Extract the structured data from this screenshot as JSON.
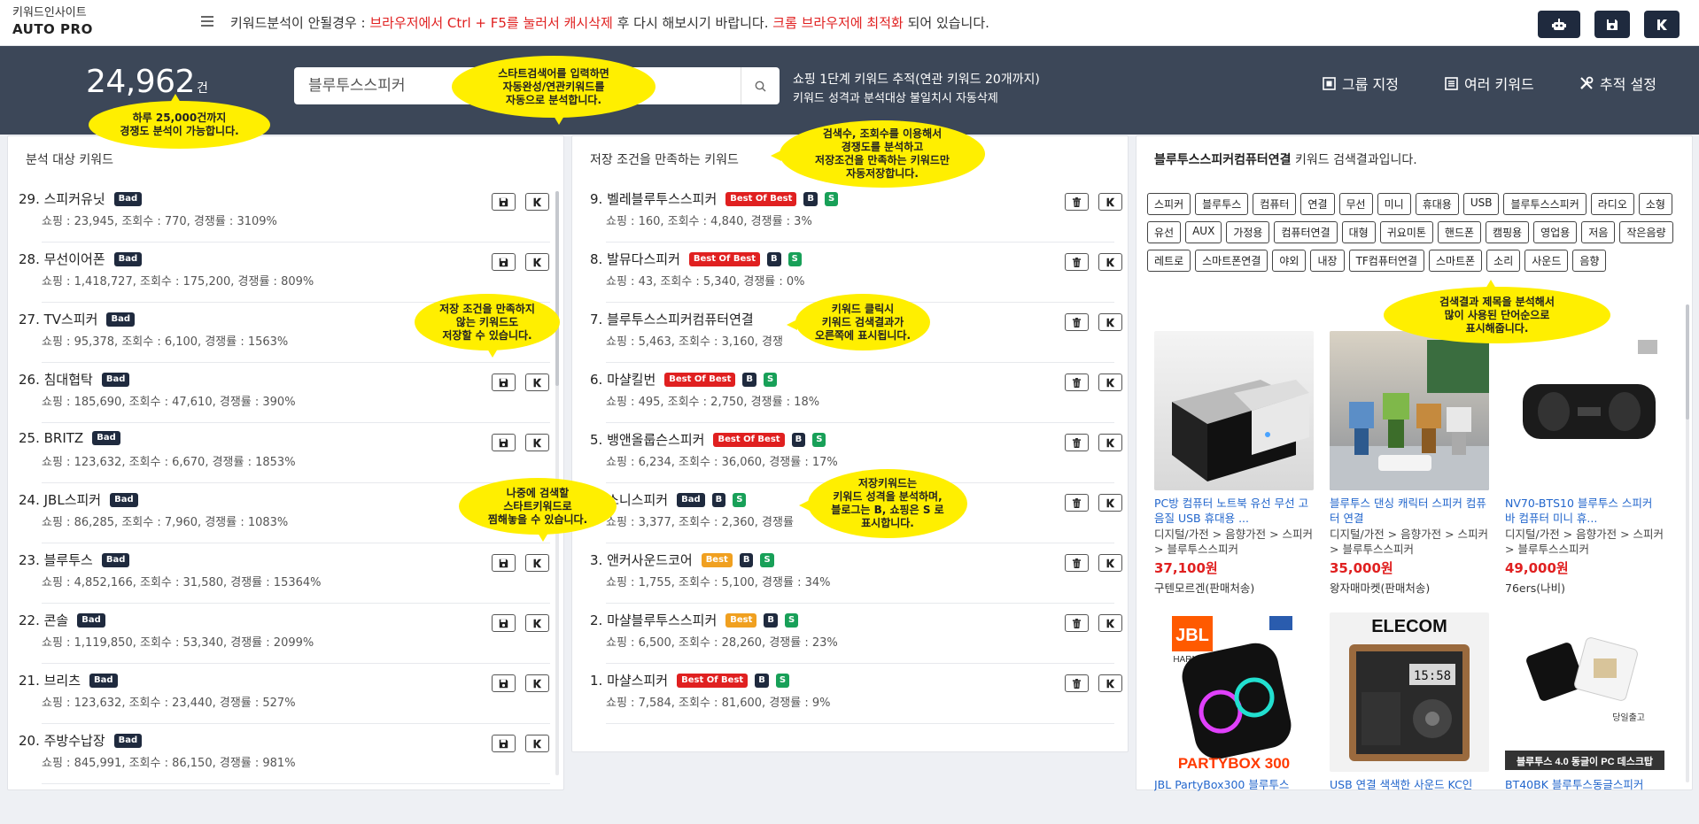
{
  "brand": {
    "line1": "키워드인사이트",
    "line2": "AUTO PRO"
  },
  "notice": {
    "part1": "키워드분석이 안될경우 : ",
    "part2": "브라우저에서 Ctrl + F5를 눌러서 캐시삭제",
    "part3": " 후 다시 해보시기 바랍니다. ",
    "part4": "크롬 브라우저에 최적화",
    "part5": " 되어 있습니다."
  },
  "hero": {
    "count": "24,962",
    "count_unit": "건",
    "search_placeholder": "블루투스스피커",
    "info_line1": "쇼핑 1단계 키워드 추적(연관 키워드 20개까지)",
    "info_line2": "키워드 성격과 분석대상 불일치시 자동삭제",
    "btn_group": "그룹 지정",
    "btn_multi": "여러 키워드",
    "btn_track": "추적 설정"
  },
  "panel_left": {
    "title": "분석 대상 키워드",
    "items": [
      {
        "label": "29. 스피커유닛",
        "badge": "Bad",
        "stats": "쇼핑 : 23,945, 조회수 : 770, 경쟁률 : 3109%"
      },
      {
        "label": "28. 무선이어폰",
        "badge": "Bad",
        "stats": "쇼핑 : 1,418,727, 조회수 : 175,200, 경쟁률 : 809%"
      },
      {
        "label": "27. TV스피커",
        "badge": "Bad",
        "stats": "쇼핑 : 95,378, 조회수 : 6,100, 경쟁률 : 1563%"
      },
      {
        "label": "26. 침대협탁",
        "badge": "Bad",
        "stats": "쇼핑 : 185,690, 조회수 : 47,610, 경쟁률 : 390%"
      },
      {
        "label": "25. BRITZ",
        "badge": "Bad",
        "stats": "쇼핑 : 123,632, 조회수 : 6,670, 경쟁률 : 1853%"
      },
      {
        "label": "24. JBL스피커",
        "badge": "Bad",
        "stats": "쇼핑 : 86,285, 조회수 : 7,960, 경쟁률 : 1083%"
      },
      {
        "label": "23. 블루투스",
        "badge": "Bad",
        "stats": "쇼핑 : 4,852,166, 조회수 : 31,580, 경쟁률 : 15364%"
      },
      {
        "label": "22. 콘솔",
        "badge": "Bad",
        "stats": "쇼핑 : 1,119,850, 조회수 : 53,340, 경쟁률 : 2099%"
      },
      {
        "label": "21. 브리츠",
        "badge": "Bad",
        "stats": "쇼핑 : 123,632, 조회수 : 23,440, 경쟁률 : 527%"
      },
      {
        "label": "20. 주방수납장",
        "badge": "Bad",
        "stats": "쇼핑 : 845,991, 조회수 : 86,150, 경쟁률 : 981%"
      }
    ]
  },
  "panel_mid": {
    "title": "저장 조건을 만족하는 키워드",
    "items": [
      {
        "label": "9. 벨레블루투스스피커",
        "badge": "Best Of Best",
        "kind": "best",
        "stats": "쇼핑 : 160, 조회수 : 4,840, 경쟁률 : 3%"
      },
      {
        "label": "8. 발뮤다스피커",
        "badge": "Best Of Best",
        "kind": "best",
        "stats": "쇼핑 : 43, 조회수 : 5,340, 경쟁률 : 0%"
      },
      {
        "label": "7. 블루투스스피커컴퓨터연결",
        "badge": "",
        "kind": "none",
        "stats": "쇼핑 : 5,463, 조회수 : 3,160, 경쟁"
      },
      {
        "label": "6. 마샬킬번",
        "badge": "Best Of Best",
        "kind": "best",
        "stats": "쇼핑 : 495, 조회수 : 2,750, 경쟁률 : 18%"
      },
      {
        "label": "5. 뱅앤올룹슨스피커",
        "badge": "Best Of Best",
        "kind": "best",
        "stats": "쇼핑 : 6,234, 조회수 : 36,060, 경쟁률 : 17%"
      },
      {
        "label": "4. 소니스피커",
        "badge": "Bad",
        "kind": "bad",
        "stats": "쇼핑 : 3,377, 조회수 : 2,360, 경쟁률"
      },
      {
        "label": "3. 앤커사운드코어",
        "badge": "Best",
        "kind": "good",
        "stats": "쇼핑 : 1,755, 조회수 : 5,100, 경쟁률 : 34%"
      },
      {
        "label": "2. 마샬블루투스스피커",
        "badge": "Best",
        "kind": "good",
        "stats": "쇼핑 : 6,500, 조회수 : 28,260, 경쟁률 : 23%"
      },
      {
        "label": "1. 마샬스피커",
        "badge": "Best Of Best",
        "kind": "best",
        "stats": "쇼핑 : 7,584, 조회수 : 81,600, 경쟁률 : 9%"
      }
    ],
    "b_label": "B",
    "s_label": "S"
  },
  "panel_right": {
    "title_bold": "블루투스스피커컴퓨터연결",
    "title_rest": " 키워드 검색결과입니다.",
    "tags": [
      "스피커",
      "블루투스",
      "컴퓨터",
      "연결",
      "무선",
      "미니",
      "휴대용",
      "USB",
      "블루투스스피커",
      "라디오",
      "소형",
      "유선",
      "AUX",
      "가정용",
      "컴퓨터연결",
      "대형",
      "귀요미톤",
      "핸드폰",
      "캠핑용",
      "영업용",
      "저음",
      "작은음량",
      "레트로",
      "스마트폰연결",
      "야외",
      "내장",
      "TF컴퓨터연결",
      "스마트폰",
      "소리",
      "사운드",
      "음향"
    ],
    "products": [
      {
        "title": "PC방 컴퓨터 노트북 유선 무선 고음질 USB 휴대용 ...",
        "category": "디지털/가전 > 음향가전 > 스피커 > 블루투스스피커",
        "price": "37,100원",
        "seller": "구텐모르겐(판매처송)"
      },
      {
        "title": "블루투스 댄싱 캐릭터 스피커 컴퓨터 연결",
        "category": "디지털/가전 > 음향가전 > 스피커 > 블루투스스피커",
        "price": "35,000원",
        "seller": "왕자매마켓(판매처송)"
      },
      {
        "title": "NV70-BTS10 블루투스 스피커 바 컴퓨터 미니 휴...",
        "category": "디지털/가전 > 음향가전 > 스피커 > 블루투스스피커",
        "price": "49,000원",
        "seller": "76ers(나비)"
      },
      {
        "title": "JBL PartyBox300 블루투스",
        "img_text": "PARTYBOX 300",
        "brand_text": "JBL",
        "brand_sub": "HARMAN"
      },
      {
        "title": "USB 연결 색색한 사운드 KC인",
        "img_text": "ELECOM",
        "clock": "15:58"
      },
      {
        "title": "BT40BK 블루투스동글스피커",
        "img_text": "블루투스 4.0 동글이 PC 데스크탑",
        "stamp": "당일출고"
      }
    ]
  },
  "tips": {
    "t1": "하루 25,000건까지\n경쟁도 분석이 가능합니다.",
    "t2": "스타트검색어를 입력하면\n자동완성/연관키워드를\n자동으로 분석합니다.",
    "t3": "검색수, 조회수를 이용해서\n경쟁도를 분석하고\n저장조건을 만족하는 키워드만\n자동저장합니다.",
    "t4": "저장 조건을 만족하지\n않는 키워드도\n저장할 수 있습니다.",
    "t5": "키워드 클릭시\n키워드 검색결과가\n오른쪽에 표시됩니다.",
    "t6": "나중에 검색할\n스타트키워드로\n찜해놓을 수 있습니다.",
    "t7": "저장키워드는\n키워드 성격을 분석하며,\n블로그는 B, 쇼핑은 S 로\n표시합니다.",
    "t8": "검색결과 제목을 분석해서\n많이 사용된 단어순으로\n표시해줍니다."
  },
  "colors": {
    "navy": "#1f2a3e",
    "hero": "#3c4758",
    "red": "#e02020",
    "green": "#18a058",
    "orange": "#f0a020",
    "tip": "#ffef00",
    "link": "#2266cc"
  }
}
